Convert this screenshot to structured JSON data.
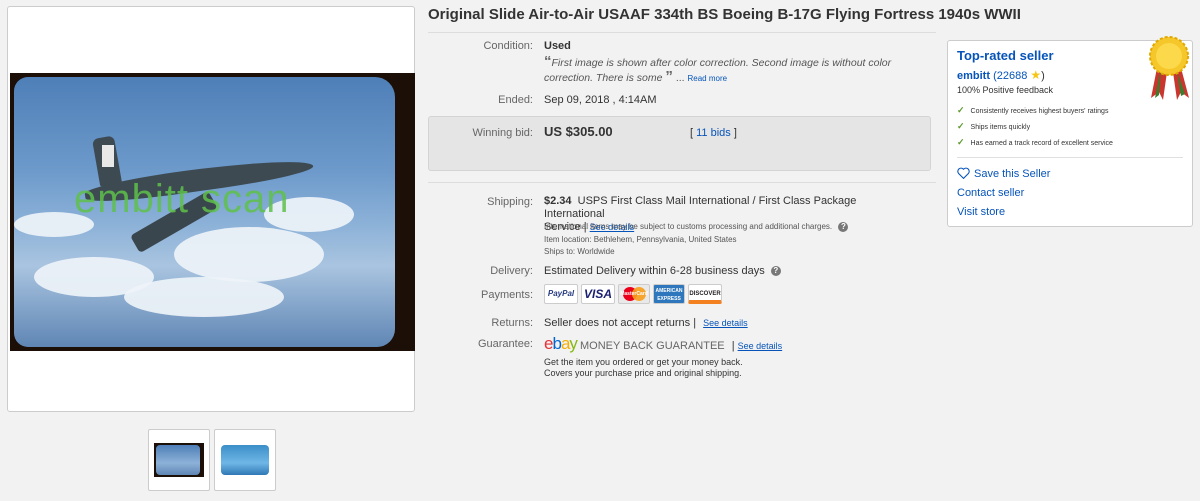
{
  "listing": {
    "title": "Original Slide Air-to-Air USAAF 334th BS Boeing B-17G Flying Fortress 1940s WWII",
    "image_watermark": "embitt scan"
  },
  "condition": {
    "label": "Condition:",
    "value": "Used",
    "quote_open": "“",
    "note": "First image is shown after color correction. Second image is without color correction. There is some",
    "quote_close": "”",
    "ellipsis": "...",
    "read_more": "Read more"
  },
  "ended": {
    "label": "Ended:",
    "value": "Sep 09, 2018 , 4:14AM"
  },
  "bid": {
    "label": "Winning bid:",
    "amount": "US $305.00",
    "bids_open": "[ ",
    "bids_link": "11 bids",
    "bids_close": " ]"
  },
  "shipping": {
    "label": "Shipping:",
    "cost": "$2.34",
    "service_line1": "USPS First Class Mail International / First Class Package International",
    "service_line2": "Service |",
    "see_details": "See details",
    "customs_note": "International items may be subject to customs processing and additional charges.",
    "item_location": "Item location:  Bethlehem, Pennsylvania, United States",
    "ships_to": "Ships to:  Worldwide"
  },
  "delivery": {
    "label": "Delivery:",
    "value": "Estimated Delivery within 6-28 business days"
  },
  "payments": {
    "label": "Payments:",
    "methods": [
      "PayPal",
      "VISA",
      "MasterCard",
      "AMERICAN EXPRESS",
      "DISCOVER"
    ]
  },
  "returns": {
    "label": "Returns:",
    "value": "Seller does not accept returns |",
    "see_details": "See details"
  },
  "guarantee": {
    "label": "Guarantee:",
    "brand": "ebay",
    "brand_letters": [
      "e",
      "b",
      "a",
      "y"
    ],
    "text": "MONEY BACK GUARANTEE",
    "sep": "|",
    "see_details": "See details",
    "line1": "Get the item you ordered or get your money back.",
    "line2": "Covers your purchase price and original shipping."
  },
  "seller": {
    "heading": "Top-rated seller",
    "name": "embitt",
    "score": "(22688",
    "score_close": ")",
    "feedback": "100% Positive feedback",
    "bullets": [
      "Consistently receives highest buyers' ratings",
      "Ships items quickly",
      "Has earned a track record of excellent service"
    ],
    "save": "Save this Seller",
    "contact": "Contact seller",
    "visit": "Visit store"
  },
  "colors": {
    "link": "#0654ba",
    "ebay_e": "#e53238",
    "ebay_b": "#0064d2",
    "ebay_a": "#f5af02",
    "ebay_y": "#86b817",
    "check": "#5a9a2b",
    "watermark": "#5fc14a"
  },
  "icons": [
    "heart-icon",
    "star-icon",
    "check-icon",
    "question-icon",
    "ribbon-medal-icon"
  ]
}
